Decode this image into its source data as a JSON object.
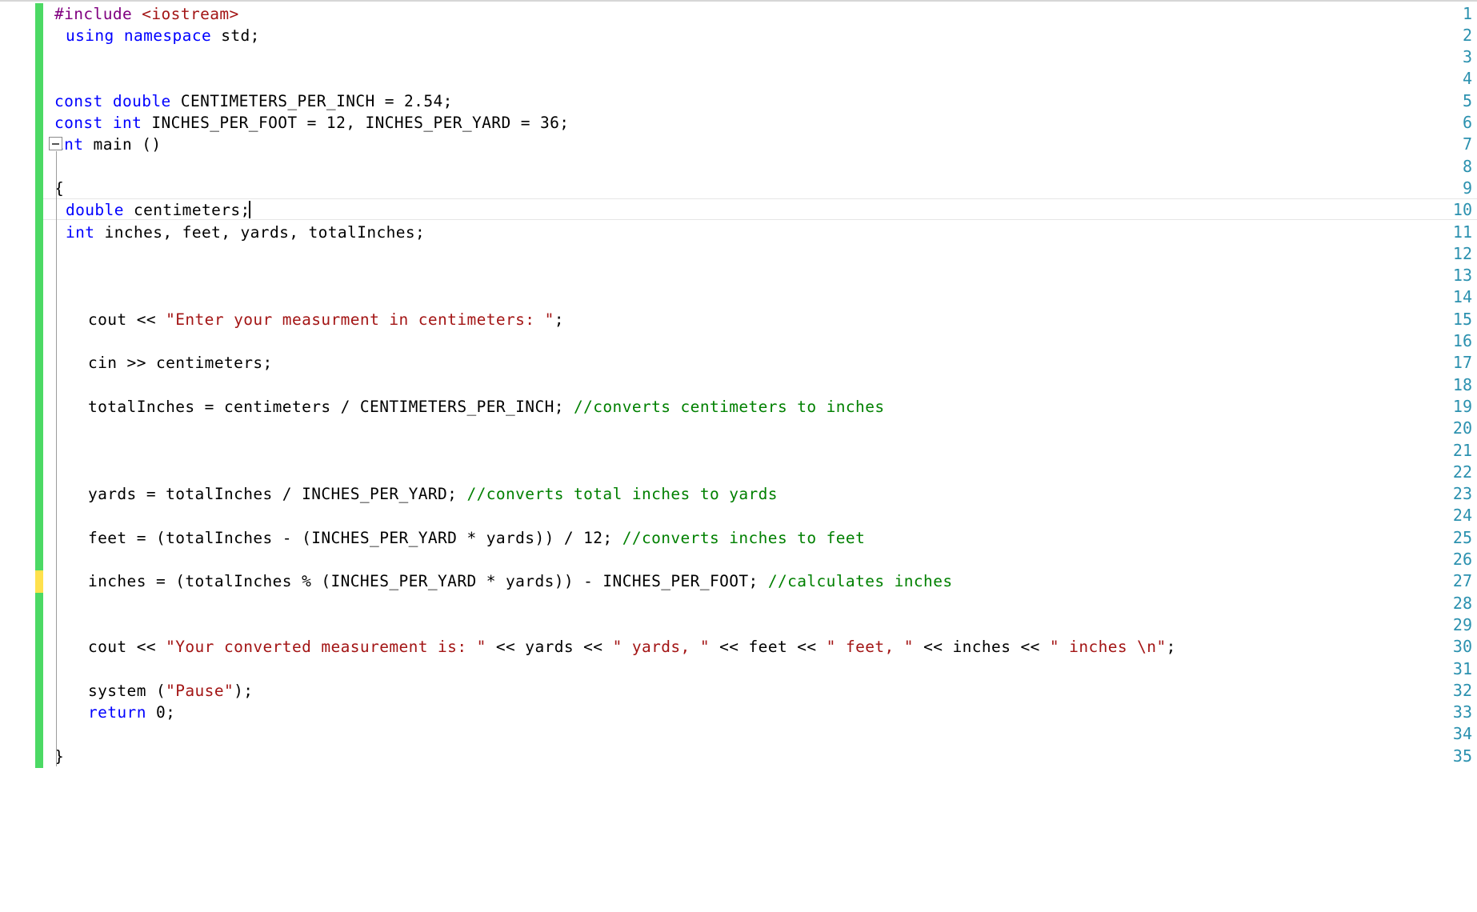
{
  "editor": {
    "language": "C++",
    "font_size_px": 19.5,
    "line_height_px": 27.3,
    "background_color": "#ffffff",
    "gutter": {
      "line_number_color": "#2b91af",
      "first_line": 1,
      "last_line": 35,
      "change_bar_saved_color": "#4cd964",
      "change_bar_unsaved_color": "#ffe14d",
      "unsaved_lines": [
        27
      ]
    },
    "current_line": 10,
    "caret": {
      "line": 10,
      "column": 21
    },
    "fold_marker": {
      "line": 7,
      "state": "expanded",
      "glyph": "minus"
    },
    "colors": {
      "keyword": "#0000ff",
      "preprocessor": "#800080",
      "header": "#a31515",
      "string": "#a31515",
      "comment": "#008000",
      "plain": "#000000",
      "line_number": "#2b91af"
    }
  },
  "code_lines": [
    {
      "n": 1,
      "indent": 0,
      "tokens": [
        {
          "t": "#include ",
          "c": "pp"
        },
        {
          "t": "<iostream>",
          "c": "hdr"
        }
      ]
    },
    {
      "n": 2,
      "indent": 1,
      "tokens": [
        {
          "t": "using",
          "c": "kw"
        },
        {
          "t": " ",
          "c": "pl"
        },
        {
          "t": "namespace",
          "c": "kw"
        },
        {
          "t": " std;",
          "c": "pl"
        }
      ]
    },
    {
      "n": 3,
      "indent": 0,
      "tokens": []
    },
    {
      "n": 4,
      "indent": 0,
      "tokens": []
    },
    {
      "n": 5,
      "indent": 0,
      "tokens": [
        {
          "t": "const",
          "c": "kw"
        },
        {
          "t": " ",
          "c": "pl"
        },
        {
          "t": "double",
          "c": "kw"
        },
        {
          "t": " CENTIMETERS_PER_INCH = 2.54;",
          "c": "pl"
        }
      ]
    },
    {
      "n": 6,
      "indent": 0,
      "tokens": [
        {
          "t": "const",
          "c": "kw"
        },
        {
          "t": " ",
          "c": "pl"
        },
        {
          "t": "int",
          "c": "kw"
        },
        {
          "t": " INCHES_PER_FOOT = 12, INCHES_PER_YARD = 36;",
          "c": "pl"
        }
      ]
    },
    {
      "n": 7,
      "indent": -1,
      "tokens": [
        {
          "t": "int",
          "c": "kw"
        },
        {
          "t": " main ()",
          "c": "pl"
        }
      ]
    },
    {
      "n": 8,
      "indent": 0,
      "tokens": []
    },
    {
      "n": 9,
      "indent": 0,
      "tokens": [
        {
          "t": "{",
          "c": "pl"
        }
      ]
    },
    {
      "n": 10,
      "indent": 1,
      "tokens": [
        {
          "t": "double",
          "c": "kw"
        },
        {
          "t": " centimeters;",
          "c": "pl"
        }
      ]
    },
    {
      "n": 11,
      "indent": 1,
      "tokens": [
        {
          "t": "int",
          "c": "kw"
        },
        {
          "t": " inches, feet, yards, totalInches;",
          "c": "pl"
        }
      ]
    },
    {
      "n": 12,
      "indent": 0,
      "tokens": []
    },
    {
      "n": 13,
      "indent": 0,
      "tokens": []
    },
    {
      "n": 14,
      "indent": 0,
      "tokens": []
    },
    {
      "n": 15,
      "indent": 3,
      "tokens": [
        {
          "t": "cout << ",
          "c": "pl"
        },
        {
          "t": "\"Enter your measurment in centimeters: \"",
          "c": "str"
        },
        {
          "t": ";",
          "c": "pl"
        }
      ]
    },
    {
      "n": 16,
      "indent": 0,
      "tokens": []
    },
    {
      "n": 17,
      "indent": 3,
      "tokens": [
        {
          "t": "cin >> centimeters;",
          "c": "pl"
        }
      ]
    },
    {
      "n": 18,
      "indent": 0,
      "tokens": []
    },
    {
      "n": 19,
      "indent": 3,
      "tokens": [
        {
          "t": "totalInches = centimeters / CENTIMETERS_PER_INCH; ",
          "c": "pl"
        },
        {
          "t": "//converts centimeters to inches",
          "c": "com"
        }
      ]
    },
    {
      "n": 20,
      "indent": 0,
      "tokens": []
    },
    {
      "n": 21,
      "indent": 0,
      "tokens": []
    },
    {
      "n": 22,
      "indent": 0,
      "tokens": []
    },
    {
      "n": 23,
      "indent": 3,
      "tokens": [
        {
          "t": "yards = totalInches / INCHES_PER_YARD; ",
          "c": "pl"
        },
        {
          "t": "//converts total inches to yards",
          "c": "com"
        }
      ]
    },
    {
      "n": 24,
      "indent": 0,
      "tokens": []
    },
    {
      "n": 25,
      "indent": 3,
      "tokens": [
        {
          "t": "feet = (totalInches - (INCHES_PER_YARD * yards)) / 12; ",
          "c": "pl"
        },
        {
          "t": "//converts inches to feet",
          "c": "com"
        }
      ]
    },
    {
      "n": 26,
      "indent": 0,
      "tokens": []
    },
    {
      "n": 27,
      "indent": 3,
      "tokens": [
        {
          "t": "inches = (totalInches % (INCHES_PER_YARD * yards)) - INCHES_PER_FOOT; ",
          "c": "pl"
        },
        {
          "t": "//calculates inches",
          "c": "com"
        }
      ]
    },
    {
      "n": 28,
      "indent": 0,
      "tokens": []
    },
    {
      "n": 29,
      "indent": 0,
      "tokens": []
    },
    {
      "n": 30,
      "indent": 3,
      "tokens": [
        {
          "t": "cout << ",
          "c": "pl"
        },
        {
          "t": "\"Your converted measurement is: \"",
          "c": "str"
        },
        {
          "t": " << yards << ",
          "c": "pl"
        },
        {
          "t": "\" yards, \"",
          "c": "str"
        },
        {
          "t": " << feet << ",
          "c": "pl"
        },
        {
          "t": "\" feet, \"",
          "c": "str"
        },
        {
          "t": " << inches << ",
          "c": "pl"
        },
        {
          "t": "\" inches \\n\"",
          "c": "str"
        },
        {
          "t": ";",
          "c": "pl"
        }
      ]
    },
    {
      "n": 31,
      "indent": 0,
      "tokens": []
    },
    {
      "n": 32,
      "indent": 3,
      "tokens": [
        {
          "t": "system (",
          "c": "pl"
        },
        {
          "t": "\"Pause\"",
          "c": "str"
        },
        {
          "t": ");",
          "c": "pl"
        }
      ]
    },
    {
      "n": 33,
      "indent": 3,
      "tokens": [
        {
          "t": "return",
          "c": "kw"
        },
        {
          "t": " 0;",
          "c": "pl"
        }
      ]
    },
    {
      "n": 34,
      "indent": 0,
      "tokens": []
    },
    {
      "n": 35,
      "indent": 0,
      "tokens": [
        {
          "t": "}",
          "c": "pl"
        }
      ]
    }
  ],
  "guides": [
    {
      "name": "scope-guide-main",
      "x": 70,
      "from_line": 7,
      "to_line": 35
    }
  ]
}
